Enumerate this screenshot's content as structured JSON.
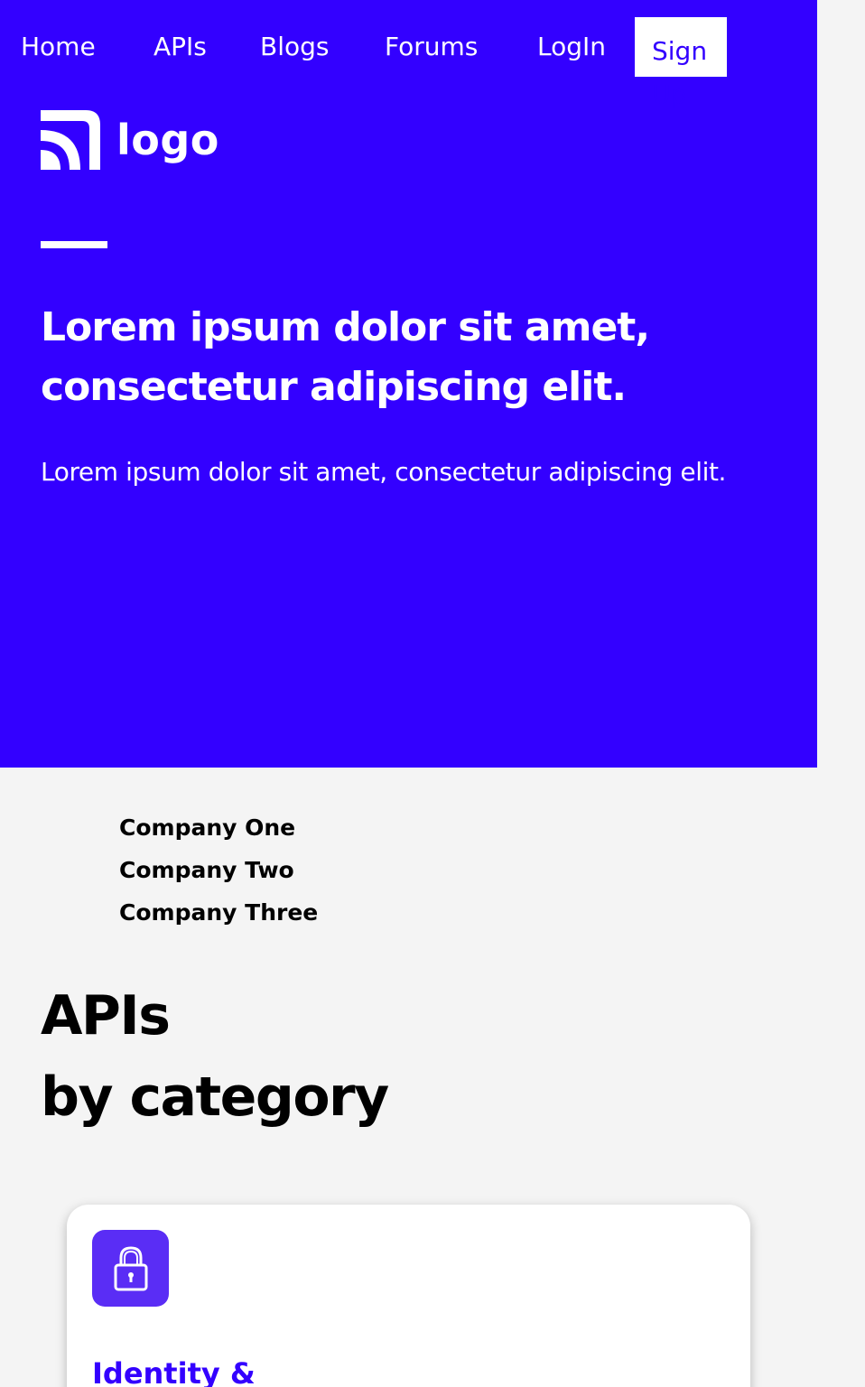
{
  "nav": {
    "items": [
      {
        "label": "Home"
      },
      {
        "label": "APIs"
      },
      {
        "label": "Blogs"
      },
      {
        "label": "Forums"
      },
      {
        "label": "LogIn"
      }
    ],
    "signup_label": "Sign Up"
  },
  "logo": {
    "text": "logo",
    "icon": "rss-icon"
  },
  "hero": {
    "title": "Lorem ipsum dolor sit amet, consectetur adipiscing elit.",
    "subtitle": "Lorem ipsum dolor sit amet, consectetur adipiscing elit.",
    "background_color": "#3300ff"
  },
  "companies": [
    "Company One",
    "Company Two",
    "Company Three"
  ],
  "apis_section": {
    "title_line1": "APIs",
    "title_line2": "by category"
  },
  "categories": [
    {
      "icon": "lock-icon",
      "title": "Identity &"
    }
  ],
  "colors": {
    "accent": "#3300ff",
    "icon_bg": "#5a2df5",
    "page_bg": "#f4f4f4"
  }
}
